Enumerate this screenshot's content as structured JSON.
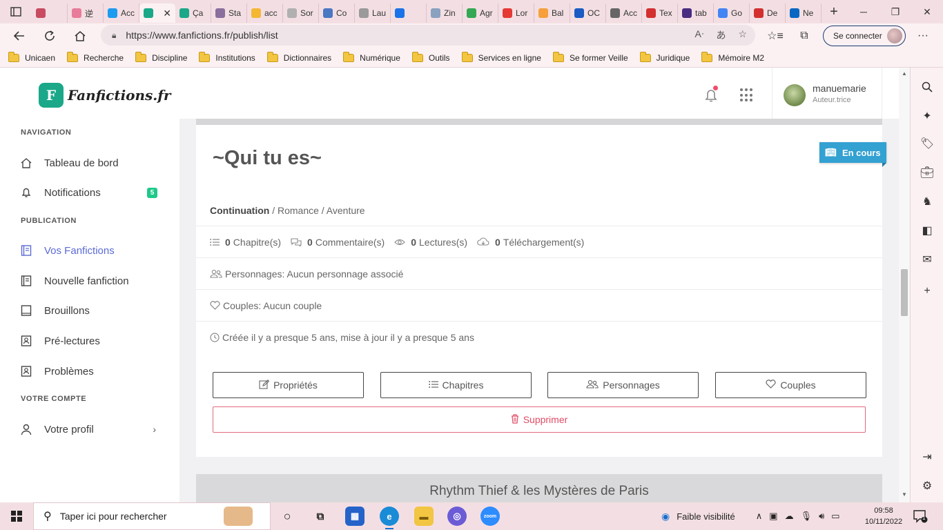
{
  "browser": {
    "tabs": [
      {
        "label": "",
        "color": "#c94b62"
      },
      {
        "label": "逆",
        "color": "#e87c9a"
      },
      {
        "label": "Acc",
        "color": "#1d9bf0"
      },
      {
        "label": "",
        "color": "#1aa889",
        "active": true
      },
      {
        "label": "Ça",
        "color": "#1aa889"
      },
      {
        "label": "Sta",
        "color": "#8a6e9e"
      },
      {
        "label": "acc",
        "color": "#f4b733"
      },
      {
        "label": "Sor",
        "color": "#b0b0b0"
      },
      {
        "label": "Co",
        "color": "#4a78c2"
      },
      {
        "label": "Lau",
        "color": "#9a9a9a"
      },
      {
        "label": "",
        "color": "#1a73e8"
      },
      {
        "label": "Zin",
        "color": "#8aa1c0"
      },
      {
        "label": "Agr",
        "color": "#34a853"
      },
      {
        "label": "Lor",
        "color": "#e53935"
      },
      {
        "label": "Bal",
        "color": "#f6a03c"
      },
      {
        "label": "OC",
        "color": "#1a5bc4"
      },
      {
        "label": "Acc",
        "color": "#666666"
      },
      {
        "label": "Tex",
        "color": "#d32f2f"
      },
      {
        "label": "tab",
        "color": "#4a2c82"
      },
      {
        "label": "Go",
        "color": "#4285f4"
      },
      {
        "label": "De",
        "color": "#d32f2f"
      },
      {
        "label": "Ne",
        "color": "#0a67c2"
      }
    ],
    "url": "https://www.fanfictions.fr/publish/list",
    "signin_label": "Se connecter",
    "bookmarks": [
      "Unicaen",
      "Recherche",
      "Discipline",
      "Institutions",
      "Dictionnaires",
      "Numérique",
      "Outils",
      "Services en ligne",
      "Se former Veille",
      "Juridique",
      "Mémoire M2"
    ]
  },
  "site": {
    "logo_text": "Fanfictions.fr",
    "logo_mark": "F",
    "nav": {
      "section_navigation": "NAVIGATION",
      "dashboard": "Tableau de bord",
      "notifications": "Notifications",
      "notifications_count": "5",
      "section_publication": "PUBLICATION",
      "my_fanfics": "Vos Fanfictions",
      "new_fanfic": "Nouvelle fanfiction",
      "drafts": "Brouillons",
      "prereads": "Pré-lectures",
      "problems": "Problèmes",
      "section_account": "VOTRE COMPTE",
      "profile": "Votre profil"
    },
    "user": {
      "name": "manuemarie",
      "role": "Auteur.trice"
    }
  },
  "fanfic": {
    "status": "En cours",
    "title": "~Qui tu es~",
    "category": "Continuation",
    "genres": " / Romance / Aventure",
    "stats": {
      "chapters_count": "0",
      "chapters_label": "Chapitre(s)",
      "comments_count": "0",
      "comments_label": "Commentaire(s)",
      "reads_count": "0",
      "reads_label": "Lectures(s)",
      "downloads_count": "0",
      "downloads_label": "Téléchargement(s)"
    },
    "characters": "Personnages: Aucun personnage associé",
    "couples": "Couples: Aucun couple",
    "dates": "Créée il y a presque 5 ans, mise à jour il y a presque 5 ans",
    "buttons": {
      "properties": "Propriétés",
      "chapters": "Chapitres",
      "characters": "Personnages",
      "couples": "Couples",
      "delete": "Supprimer"
    }
  },
  "next_fanfic": {
    "title": "Rhythm Thief & les Mystères de Paris"
  },
  "taskbar": {
    "search_placeholder": "Taper ici pour rechercher",
    "weather": "Faible visibilité",
    "time": "09:58",
    "date": "10/11/2022",
    "notif_count": "1"
  },
  "colors": {
    "accent": "#5a6ad6",
    "brand": "#1aa889",
    "status": "#33a1d1",
    "danger": "#e04b64",
    "badge": "#1ec98a"
  }
}
